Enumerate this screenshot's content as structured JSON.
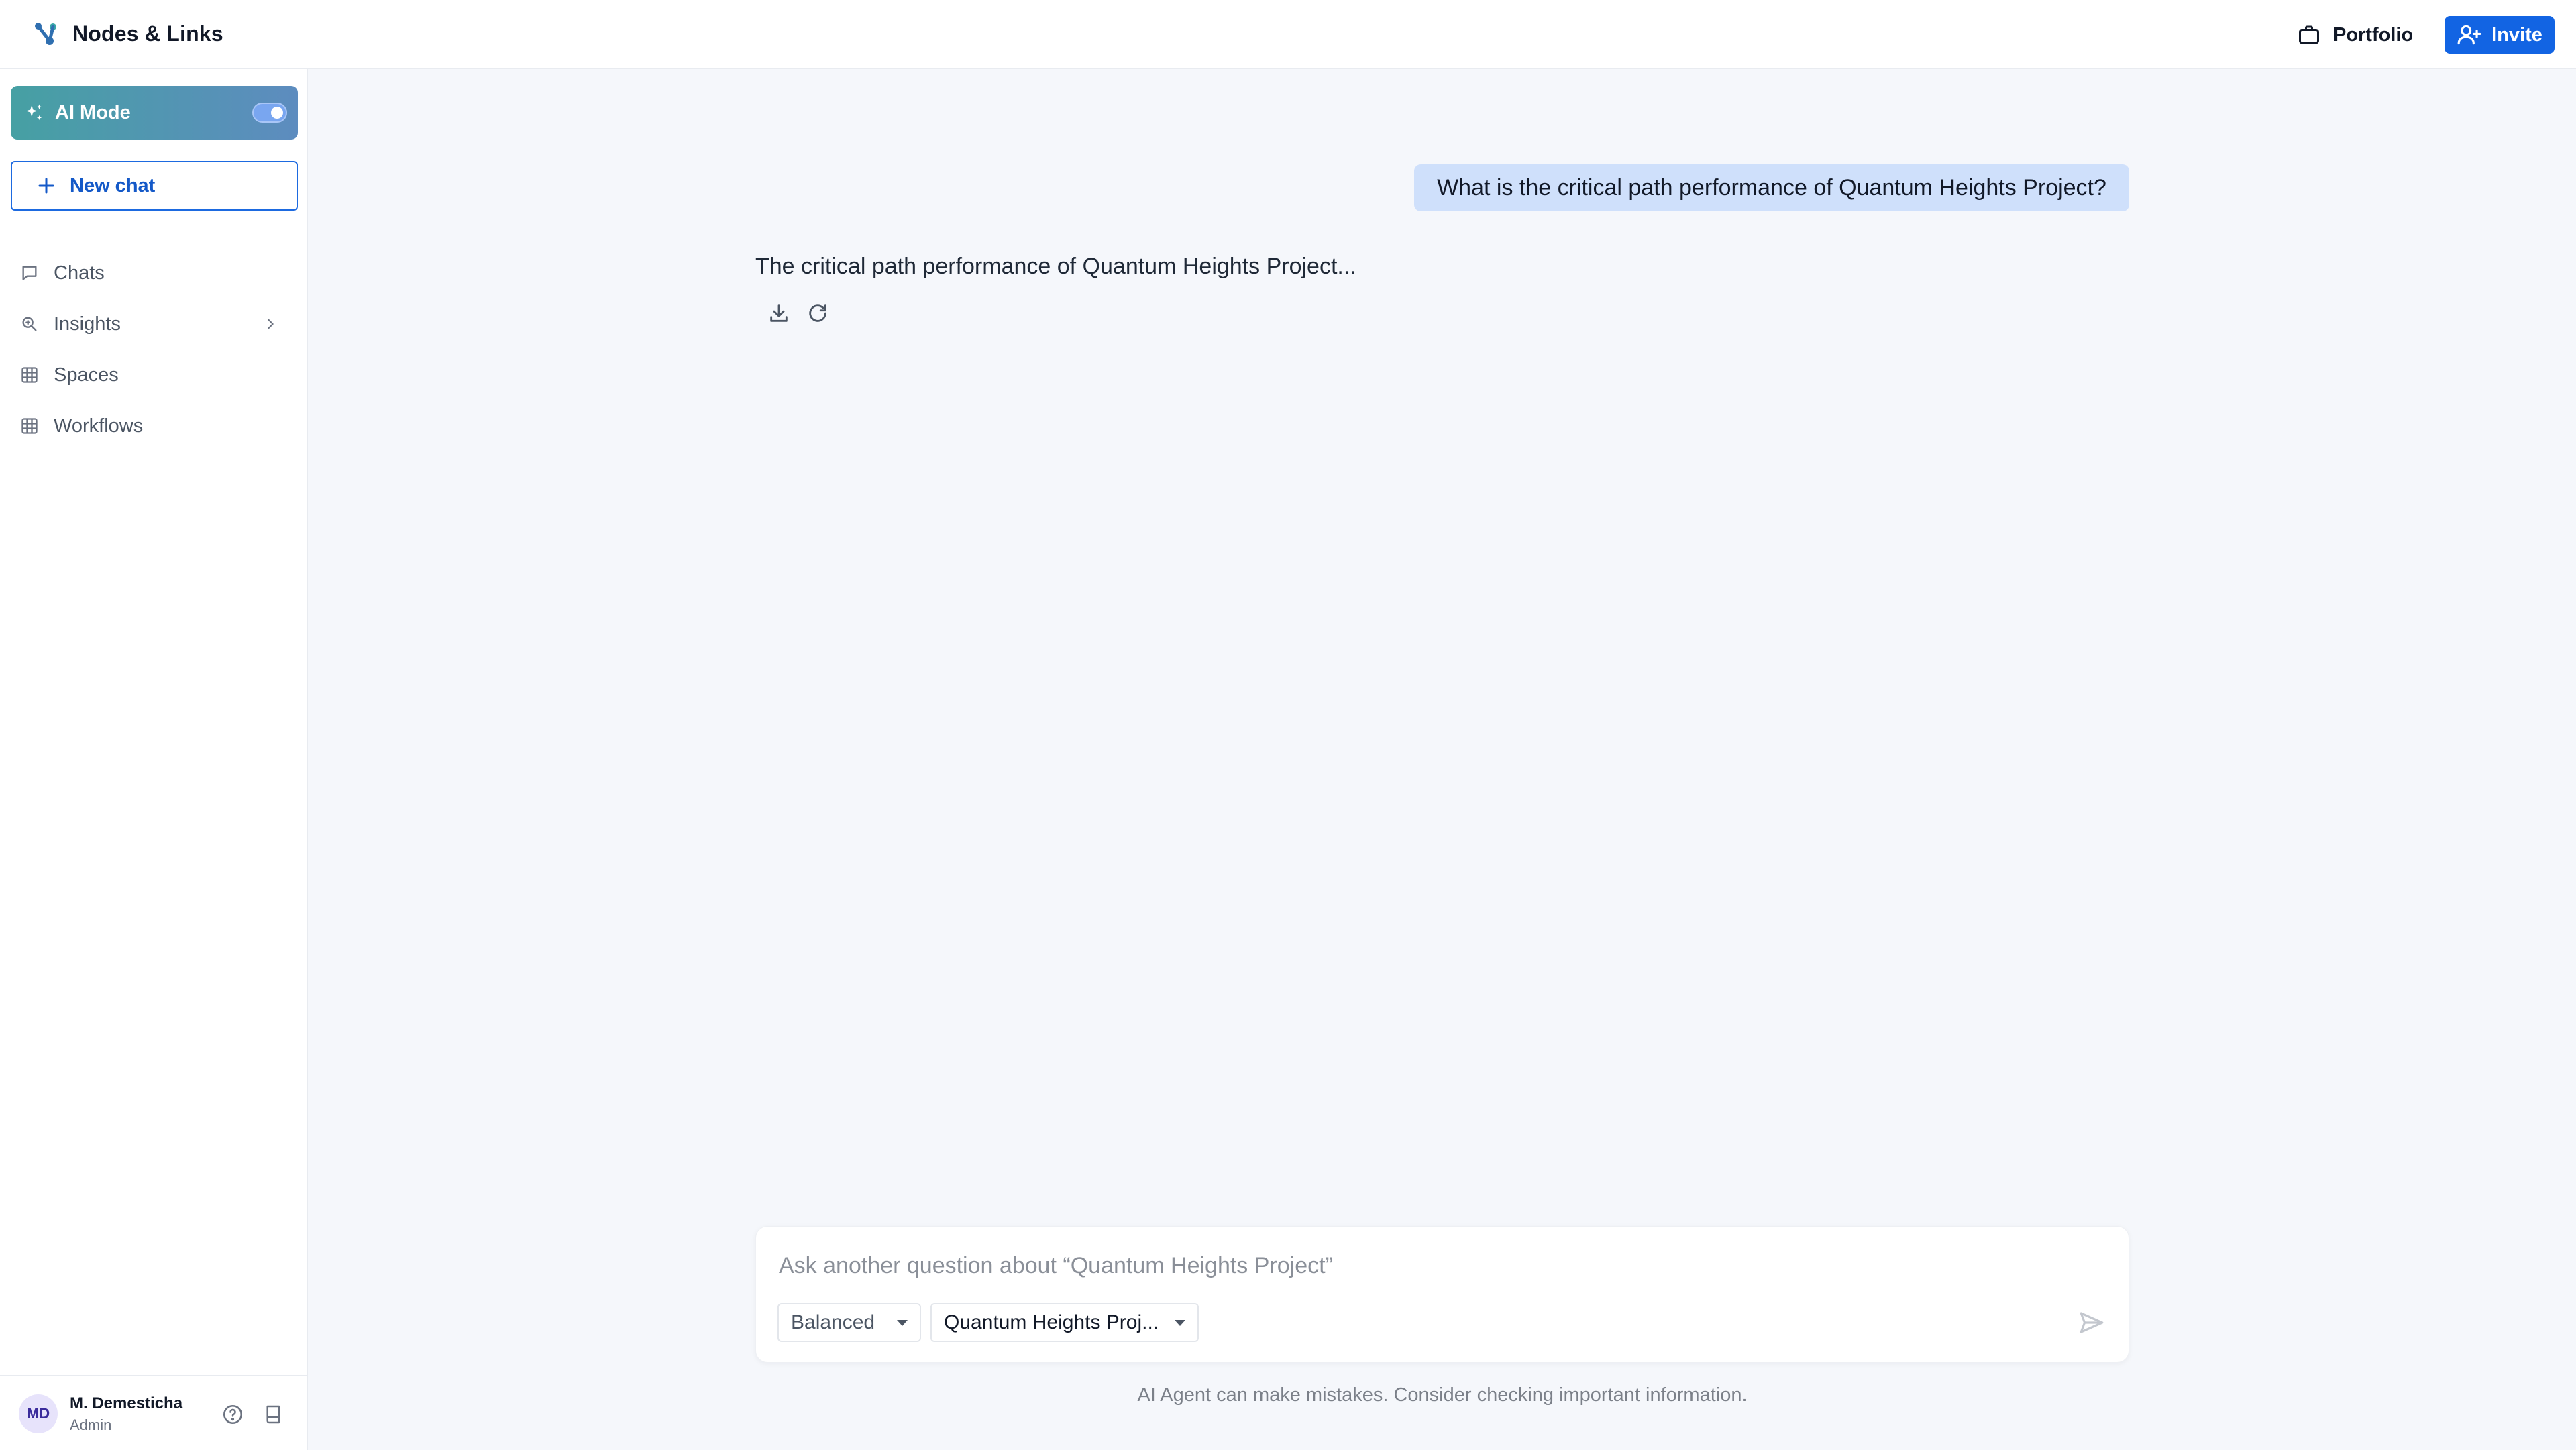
{
  "app": {
    "name": "Nodes & Links"
  },
  "header": {
    "portfolio_label": "Portfolio",
    "invite_label": "Invite"
  },
  "sidebar": {
    "ai_mode": {
      "label": "AI Mode",
      "enabled": true
    },
    "new_chat_label": "New chat",
    "items": [
      {
        "label": "Chats",
        "icon": "chat-bubble-icon"
      },
      {
        "label": "Insights",
        "icon": "search-zoom-icon",
        "has_submenu": true
      },
      {
        "label": "Spaces",
        "icon": "grid-icon"
      },
      {
        "label": "Workflows",
        "icon": "grid-icon"
      }
    ]
  },
  "user": {
    "initials": "MD",
    "name": "M. Demesticha",
    "role": "Admin"
  },
  "chat": {
    "question": "What is the critical path performance of Quantum Heights Project?",
    "answer": "The critical path performance of Quantum Heights Project..."
  },
  "composer": {
    "placeholder": "Ask another question about “Quantum Heights Project”",
    "value": "",
    "mode": "Balanced",
    "project": "Quantum Heights Proj..."
  },
  "disclaimer": "AI Agent can make mistakes. Consider checking important information.",
  "colors": {
    "accent": "#1264e3",
    "ai_gradient_start": "#46a0a3",
    "ai_gradient_end": "#5d8cbf",
    "user_bubble": "#cfe0fb",
    "background": "#f5f7fb"
  }
}
